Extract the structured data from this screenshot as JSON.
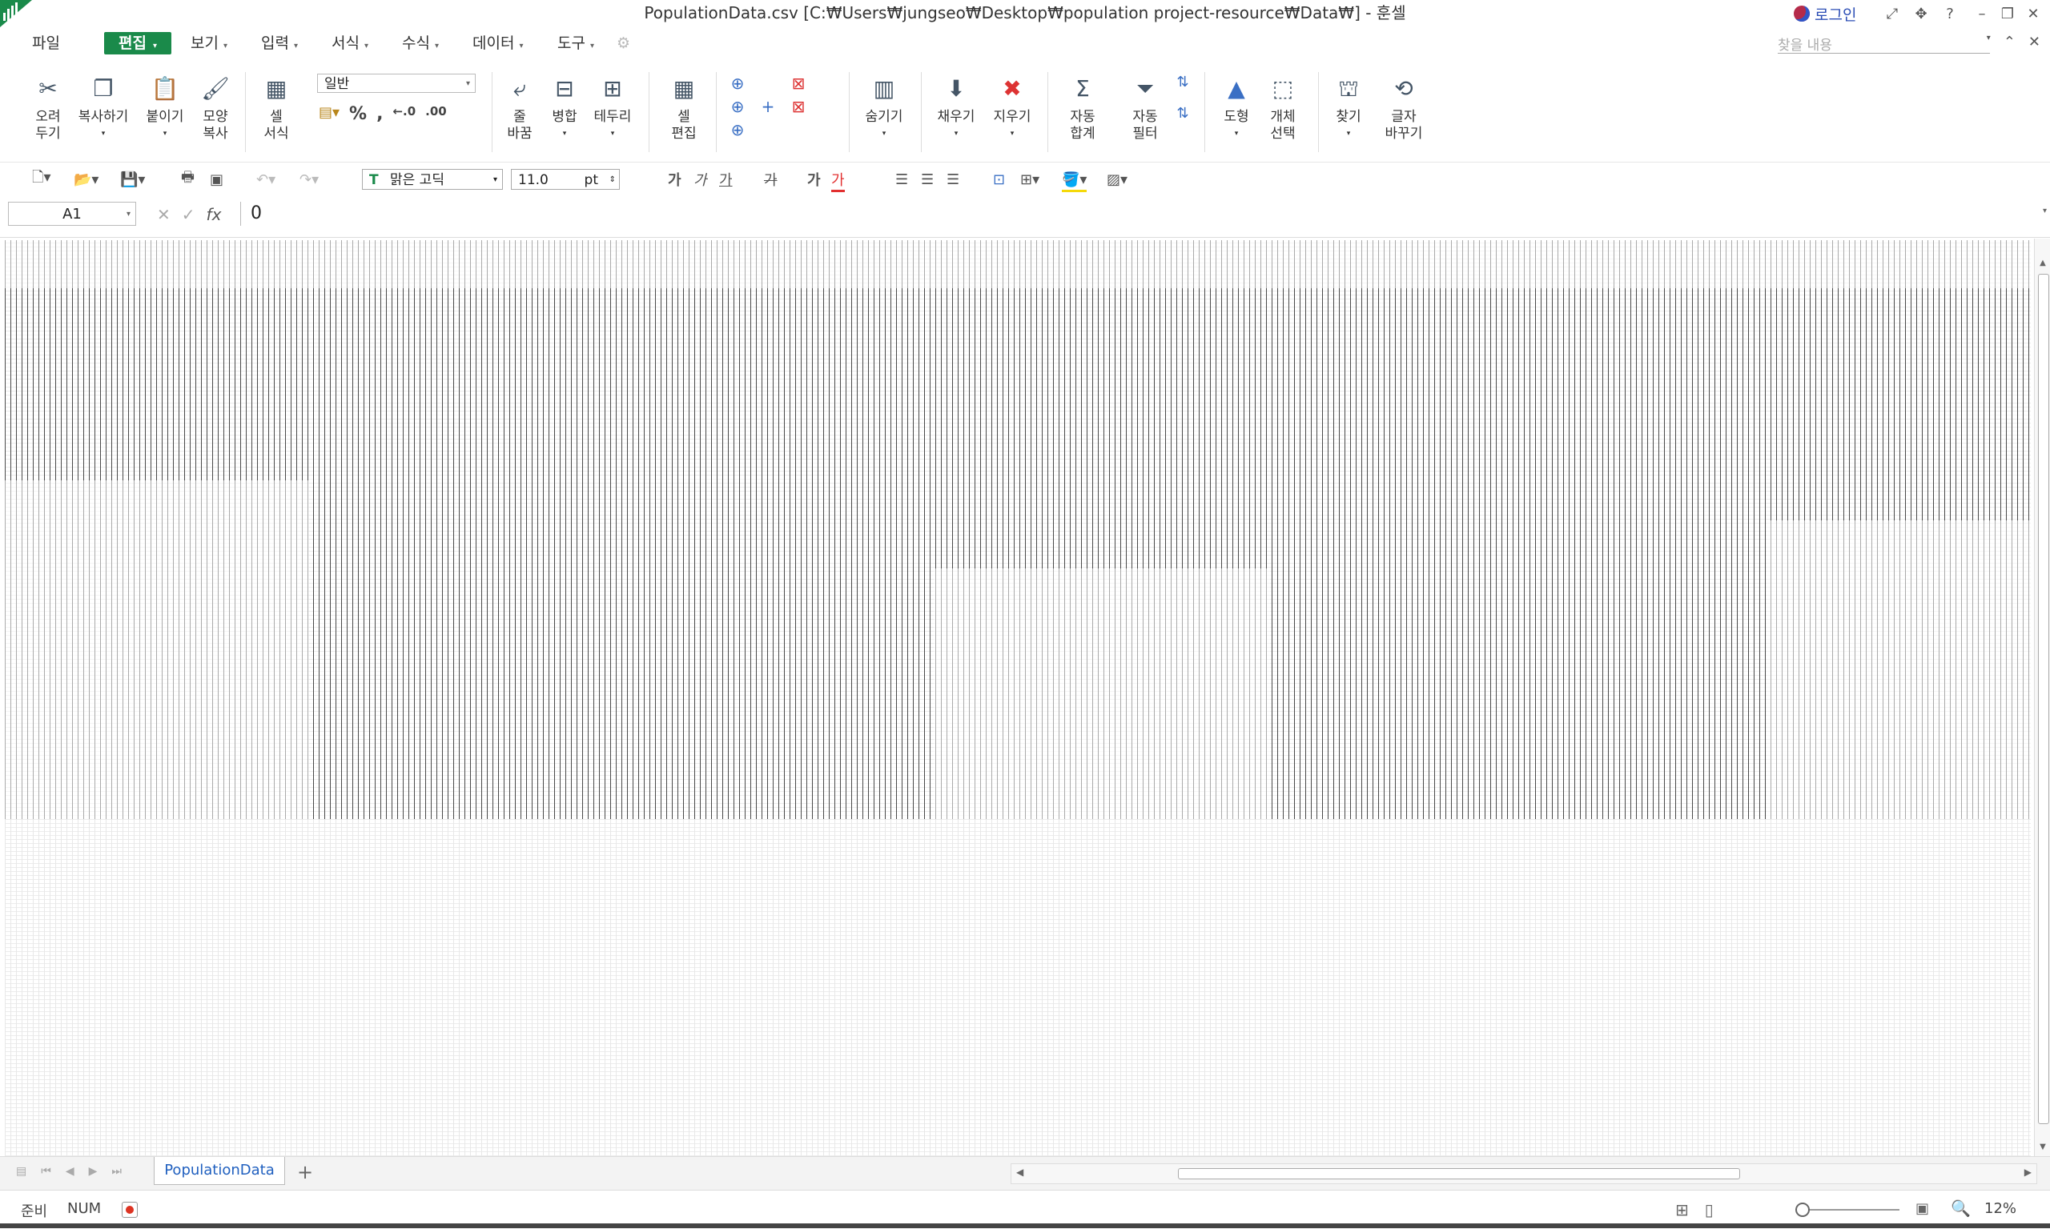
{
  "window": {
    "title": "PopulationData.csv [C:₩Users₩jungseo₩Desktop₩population project-resource₩Data₩] - 훈셀",
    "login": "로그인",
    "title_icons": [
      "fullscreen-icon",
      "move-icon",
      "help-icon"
    ],
    "help": "?",
    "controls": [
      "minimize",
      "restore",
      "close"
    ]
  },
  "menu": {
    "file": "파일",
    "edit": "편집",
    "view": "보기",
    "insert": "입력",
    "format": "서식",
    "formula": "수식",
    "data": "데이터",
    "tools": "도구",
    "search_placeholder": "찾을 내용"
  },
  "ribbon": {
    "cut": [
      "오려",
      "두기"
    ],
    "copy": "복사하기",
    "paste": "붙이기",
    "format_painter": [
      "모양",
      "복사"
    ],
    "cell_format": [
      "셀",
      "서식"
    ],
    "number_format": "일반",
    "percent": "%",
    "comma": ",",
    "inc_decimal": "←.0",
    "dec_decimal": ".00",
    "wrap": [
      "줄",
      "바꿈"
    ],
    "merge": "병합",
    "border": "테두리",
    "cell_edit": [
      "셀",
      "편집"
    ],
    "hide": "숨기기",
    "fill": "채우기",
    "clear": "지우기",
    "autosum": [
      "자동",
      "합계"
    ],
    "autofilter": [
      "자동",
      "필터"
    ],
    "shape": "도형",
    "select_object": [
      "개체",
      "선택"
    ],
    "find": "찾기",
    "replace": [
      "글자",
      "바꾸기"
    ]
  },
  "toolbar": {
    "font": "맑은 고딕",
    "font_size": "11.0",
    "font_unit": "pt",
    "bold": "가",
    "italic": "가",
    "underline": "가",
    "strike": "가",
    "shadow": "가",
    "font_color": "가",
    "accent_color": "#e23030",
    "fill_color": "#f5d90a"
  },
  "formula_bar": {
    "cell_ref": "A1",
    "fx": "fx",
    "value": "0"
  },
  "sheet": {
    "tab_name": "PopulationData",
    "add": "+"
  },
  "status": {
    "ready": "준비",
    "num": "NUM",
    "zoom": "12%"
  },
  "colors": {
    "accent_green": "#1a8a4a",
    "tab_text": "#1f5fbf"
  }
}
